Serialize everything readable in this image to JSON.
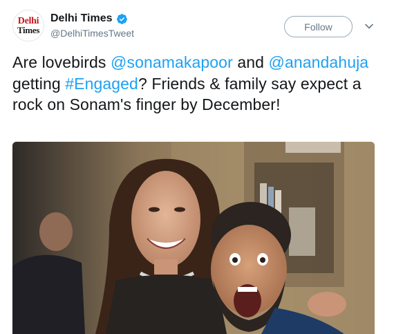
{
  "account": {
    "avatar_line1": "Delhi",
    "avatar_line2": "Times",
    "display_name": "Delhi Times",
    "handle": "@DelhiTimesTweet",
    "verified_icon": "verified-badge-icon"
  },
  "actions": {
    "follow_label": "Follow",
    "more_icon": "chevron-down-icon"
  },
  "tweet": {
    "t1": "Are lovebirds ",
    "m1": "@sonamakapoor",
    "t2": " and ",
    "m2": "@anandahuja",
    "t3": " getting ",
    "h1": "#Engaged",
    "t4": "? Friends & family say expect a rock on Sonam's finger by December!"
  },
  "media": {
    "type": "photo"
  },
  "colors": {
    "link": "#1da1f2",
    "secondary_text": "#657786",
    "primary_text": "#14171a"
  }
}
